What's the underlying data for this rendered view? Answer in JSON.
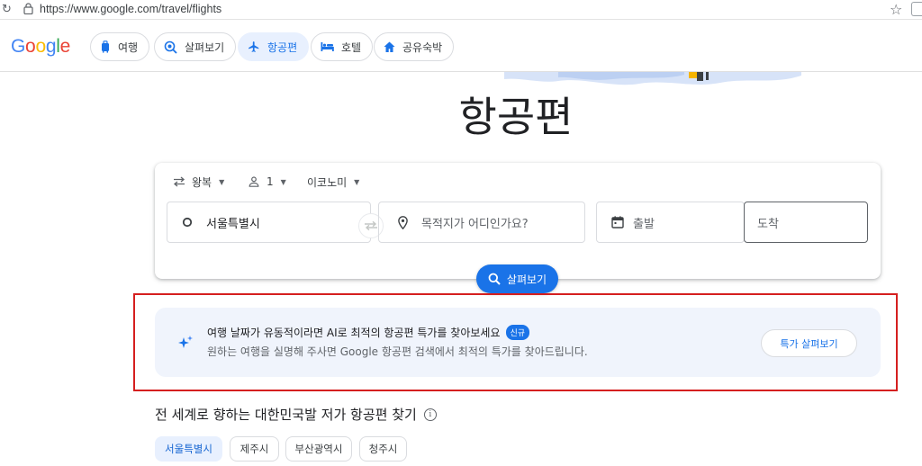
{
  "browser": {
    "url": "https://www.google.com/travel/flights"
  },
  "header": {
    "logo_letters": [
      {
        "ch": "G",
        "color": "#4285F4"
      },
      {
        "ch": "o",
        "color": "#EA4335"
      },
      {
        "ch": "o",
        "color": "#FBBC05"
      },
      {
        "ch": "g",
        "color": "#4285F4"
      },
      {
        "ch": "l",
        "color": "#34A853"
      },
      {
        "ch": "e",
        "color": "#EA4335"
      }
    ],
    "tabs": [
      {
        "label": "여행",
        "icon": "luggage-icon"
      },
      {
        "label": "살펴보기",
        "icon": "explore-icon"
      },
      {
        "label": "항공편",
        "icon": "airplane-icon",
        "active": true
      },
      {
        "label": "호텔",
        "icon": "bed-icon"
      },
      {
        "label": "공유숙박",
        "icon": "home-icon"
      }
    ]
  },
  "hero": {
    "title": "항공편"
  },
  "search": {
    "trip_type": "왕복",
    "passengers": "1",
    "cabin_class": "이코노미",
    "origin_value": "서울특별시",
    "destination_placeholder": "목적지가 어디인가요?",
    "departure_placeholder": "출발",
    "return_placeholder": "도착",
    "search_label": "살펴보기"
  },
  "promo": {
    "title": "여행 날짜가 유동적이라면 AI로 최적의 항공편 특가를 찾아보세요",
    "badge": "신규",
    "body": "원하는 여행을 실명해 주사면 Google 항공편 검색에서 최적의 특가를 찾아드립니다.",
    "button": "특가 살펴보기"
  },
  "cheap_flights": {
    "title": "전 세계로 향하는 대한민국발 저가 항공편 찾기",
    "info_icon": "i",
    "cities": [
      "서울특별시",
      "제주시",
      "부산광역시",
      "청주시"
    ]
  },
  "colors": {
    "accent": "#1a73e8",
    "highlight_box": "#d51f1f",
    "promo_bg": "#f0f4fc"
  }
}
